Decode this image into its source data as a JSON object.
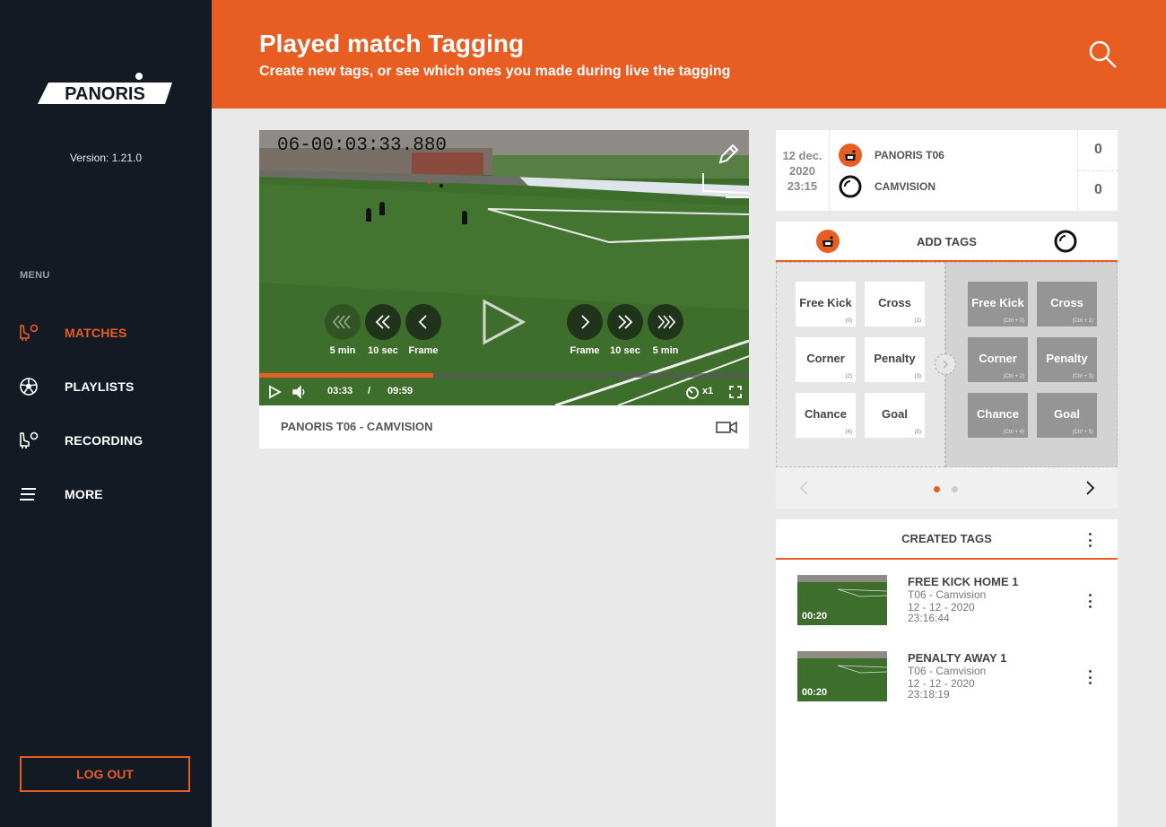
{
  "sidebar": {
    "logo_text": "PANORIS",
    "version": "Version: 1.21.0",
    "menu_title": "MENU",
    "items": [
      {
        "label": "MATCHES",
        "icon": "boot-ball-icon",
        "active": true
      },
      {
        "label": "PLAYLISTS",
        "icon": "soccer-ball-icon",
        "active": false
      },
      {
        "label": "RECORDING",
        "icon": "boot-ball-icon",
        "active": false
      },
      {
        "label": "MORE",
        "icon": "hamburger-icon",
        "active": false
      }
    ],
    "logout": "LOG OUT"
  },
  "header": {
    "title": "Played match Tagging",
    "subtitle": "Create new tags, or see which ones you made during live the tagging"
  },
  "player": {
    "timecode": "06-00:03:33.880",
    "controls": {
      "back_5min": "5 min",
      "back_10sec": "10 sec",
      "back_frame": "Frame",
      "fwd_frame": "Frame",
      "fwd_10sec": "10 sec",
      "fwd_5min": "5 min"
    },
    "current_time": "03:33",
    "separator": "/",
    "duration": "09:59",
    "progress": 0.356,
    "speed": "x1",
    "title": "PANORIS T06 - CAMVISION"
  },
  "match": {
    "date_day": "12 dec.",
    "date_year": "2020",
    "date_time": "23:15",
    "home_team": "PANORIS T06",
    "away_team": "CAMVISION",
    "home_score": "0",
    "away_score": "0"
  },
  "add_tags": {
    "title": "ADD TAGS",
    "home_tags": [
      {
        "label": "Free Kick",
        "key": "(0)"
      },
      {
        "label": "Cross",
        "key": "(1)"
      },
      {
        "label": "Corner",
        "key": "(2)"
      },
      {
        "label": "Penalty",
        "key": "(3)"
      },
      {
        "label": "Chance",
        "key": "(4)"
      },
      {
        "label": "Goal",
        "key": "(5)"
      }
    ],
    "away_tags": [
      {
        "label": "Free Kick",
        "key": "(Ctrl + 0)"
      },
      {
        "label": "Cross",
        "key": "(Ctrl + 1)"
      },
      {
        "label": "Corner",
        "key": "(Ctrl + 2)"
      },
      {
        "label": "Penalty",
        "key": "(Ctrl + 3)"
      },
      {
        "label": "Chance",
        "key": "(Ctrl + 4)"
      },
      {
        "label": "Goal",
        "key": "(Ctrl + 5)"
      }
    ],
    "page": 1,
    "pages": 2
  },
  "created_tags": {
    "title": "CREATED TAGS",
    "items": [
      {
        "title": "FREE KICK HOME 1",
        "source": "T06 - Camvision",
        "date": "12 - 12 - 2020",
        "time": "23:16:44",
        "duration": "00:20"
      },
      {
        "title": "PENALTY AWAY 1",
        "source": "T06 - Camvision",
        "date": "12 - 12 - 2020",
        "time": "23:18:19",
        "duration": "00:20"
      }
    ]
  },
  "colors": {
    "accent": "#e85d22",
    "sidebar_bg": "#141a24",
    "page_bg": "#e9e9e9"
  }
}
